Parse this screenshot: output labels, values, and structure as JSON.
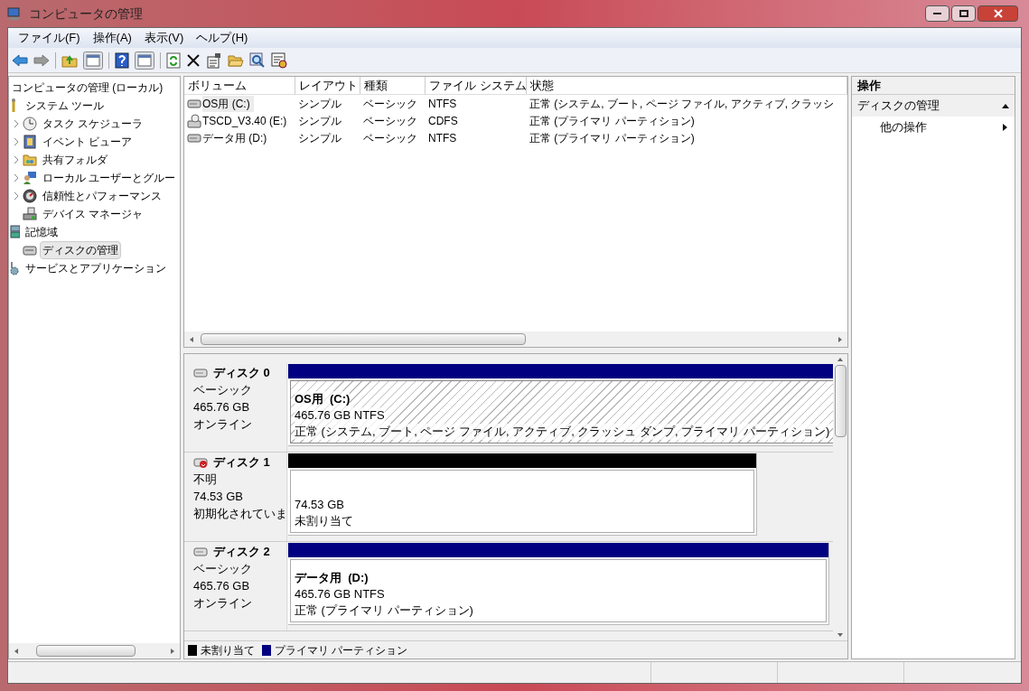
{
  "window": {
    "title": "コンピュータの管理"
  },
  "menu": [
    "ファイル(F)",
    "操作(A)",
    "表示(V)",
    "ヘルプ(H)"
  ],
  "tree": [
    {
      "label": "コンピュータの管理 (ローカル)",
      "selected": false,
      "children": [
        {
          "label": "システム ツール",
          "selected": false,
          "children": [
            {
              "label": "タスク スケジューラ",
              "expandable": true,
              "selected": false
            },
            {
              "label": "イベント ビューア",
              "expandable": true,
              "selected": false
            },
            {
              "label": "共有フォルダ",
              "expandable": true,
              "selected": false
            },
            {
              "label": "ローカル ユーザーとグルー",
              "expandable": true,
              "selected": false
            },
            {
              "label": "信頼性とパフォーマンス",
              "expandable": true,
              "selected": false
            },
            {
              "label": "デバイス マネージャ",
              "expandable": false,
              "selected": false
            }
          ]
        },
        {
          "label": "記憶域",
          "selected": false,
          "children": [
            {
              "label": "ディスクの管理",
              "expandable": false,
              "selected": true
            }
          ]
        },
        {
          "label": "サービスとアプリケーション",
          "selected": false
        }
      ]
    }
  ],
  "volumes": {
    "columns": [
      "ボリューム",
      "レイアウト",
      "種類",
      "ファイル システム",
      "状態"
    ],
    "rows": [
      {
        "kind": "hdd",
        "selected": true,
        "cells": [
          "OS用 (C:)",
          "シンプル",
          "ベーシック",
          "NTFS",
          "正常 (システム, ブート, ページ ファイル, アクティブ, クラッシ"
        ]
      },
      {
        "kind": "cd",
        "selected": false,
        "cells": [
          "TSCD_V3.40 (E:)",
          "シンプル",
          "ベーシック",
          "CDFS",
          "正常 (プライマリ パーティション)"
        ]
      },
      {
        "kind": "hdd",
        "selected": false,
        "cells": [
          "データ用 (D:)",
          "シンプル",
          "ベーシック",
          "NTFS",
          "正常 (プライマリ パーティション)"
        ]
      }
    ]
  },
  "disks": [
    {
      "kind": "online",
      "name": "ディスク 0",
      "type": "ベーシック",
      "size": "465.76 GB",
      "status": "オンライン",
      "partitions": [
        {
          "kind": "primary",
          "selected": true,
          "title": "OS用  (C:)",
          "size": "465.76 GB NTFS",
          "status": "正常 (システム, ブート, ページ ファイル, アクティブ, クラッシュ ダンプ, プライマリ パーティション)"
        }
      ]
    },
    {
      "kind": "unknown",
      "name": "ディスク 1",
      "type": "不明",
      "size": "74.53 GB",
      "status": "初期化されていま",
      "partitions": [
        {
          "kind": "unallocated",
          "selected": false,
          "size": "74.53 GB",
          "status": "未割り当て"
        }
      ]
    },
    {
      "kind": "online",
      "name": "ディスク 2",
      "type": "ベーシック",
      "size": "465.76 GB",
      "status": "オンライン",
      "partitions": [
        {
          "kind": "primary",
          "selected": false,
          "title": "データ用  (D:)",
          "size": "465.76 GB NTFS",
          "status": "正常 (プライマリ パーティション)"
        }
      ]
    }
  ],
  "legend": [
    {
      "label": "未割り当て",
      "color": "#000000"
    },
    {
      "label": "プライマリ パーティション",
      "color": "#000080"
    }
  ],
  "actions": {
    "title": "操作",
    "section": {
      "label": "ディスクの管理",
      "expanded": true
    },
    "items": [
      "他の操作"
    ]
  }
}
